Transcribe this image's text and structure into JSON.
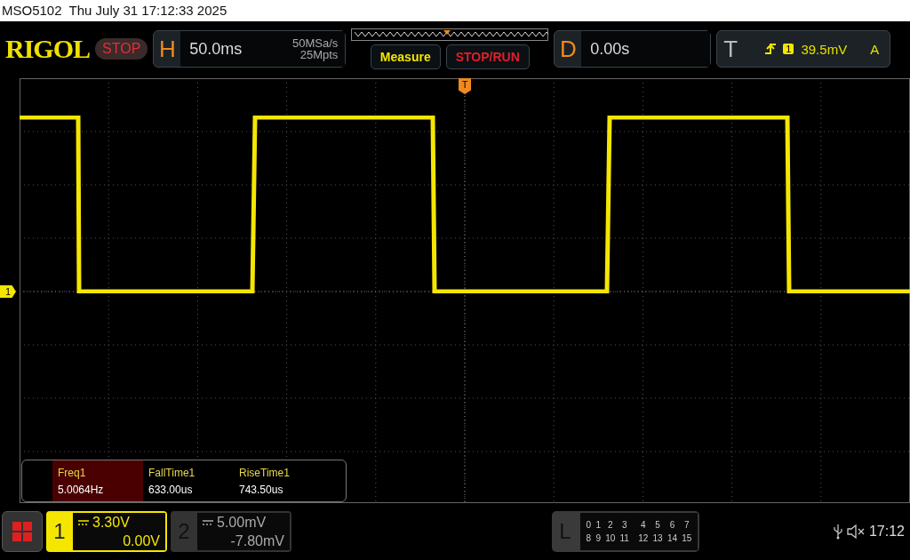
{
  "window": {
    "title": "MSO5102  Thu July 31 17:12:33 2025"
  },
  "toolbar": {
    "logo": "RIGOL",
    "run_state": "STOP",
    "horizontal": {
      "label": "H",
      "timebase": "50.0ms",
      "sample_rate": "50MSa/s",
      "memory_depth": "25Mpts"
    },
    "buttons": [
      {
        "label": "Measure",
        "kind": "menu"
      },
      {
        "label": "STOP/RUN",
        "kind": "control"
      }
    ],
    "delay": {
      "label": "D",
      "value": "0.00s"
    },
    "trigger": {
      "label": "T",
      "source": "1",
      "level": "39.5mV",
      "mode": "A"
    }
  },
  "screen": {
    "channel_marker": "1",
    "trigger_marker": "T"
  },
  "measurements": [
    {
      "name": "Freq1",
      "value": "5.0064Hz",
      "selected": true
    },
    {
      "name": "FallTime1",
      "value": "633.00us",
      "selected": false
    },
    {
      "name": "RiseTime1",
      "value": "743.50us",
      "selected": false
    }
  ],
  "channels": [
    {
      "number": "1",
      "scale": "3.30V",
      "offset": "0.00V",
      "selected": true
    },
    {
      "number": "2",
      "scale": "5.00mV",
      "offset": "-7.80mV",
      "selected": false
    }
  ],
  "logic": {
    "label": "L",
    "bits": [
      "0",
      "1",
      "2",
      "3",
      "4",
      "5",
      "6",
      "7",
      "8",
      "9",
      "10",
      "11",
      "12",
      "13",
      "14",
      "15"
    ]
  },
  "status": {
    "time": "17:12"
  }
}
